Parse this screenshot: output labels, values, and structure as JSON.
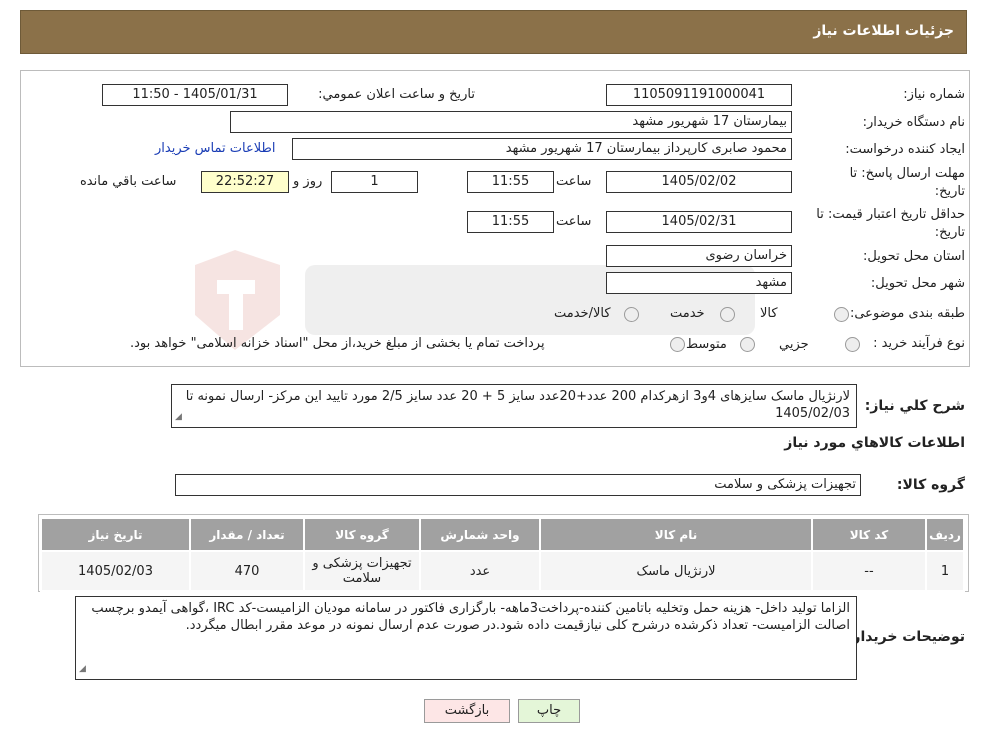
{
  "header": {
    "title": "جزئیات اطلاعات نیاز"
  },
  "fields": {
    "need_number_label": "شماره نیاز:",
    "need_number": "1105091191000041",
    "announce_label": "تاریخ و ساعت اعلان عمومي:",
    "announce_value": "1405/01/31 - 11:50",
    "buyer_org_label": "نام دستگاه خریدار:",
    "buyer_org": "بیمارستان 17 شهریور مشهد",
    "creator_label": "ایجاد کننده درخواست:",
    "creator": "محمود صابری کارپرداز بیمارستان 17 شهریور مشهد",
    "contact_link": "اطلاعات تماس خریدار",
    "deadline_label_1": "مهلت ارسال پاسخ: تا",
    "deadline_label_2": "تاریخ:",
    "deadline_date": "1405/02/02",
    "time_label": "ساعت",
    "deadline_time": "11:55",
    "days_value": "1",
    "days_label": "روز و",
    "remaining_time": "22:52:27",
    "remaining_label": "ساعت باقي مانده",
    "validity_label_1": "حداقل تاریخ اعتبار قیمت: تا",
    "validity_label_2": "تاریخ:",
    "validity_date": "1405/02/31",
    "validity_time": "11:55",
    "province_label": "استان محل تحویل:",
    "province": "خراسان رضوی",
    "city_label": "شهر محل تحویل:",
    "city": "مشهد",
    "category_label": "طبقه بندی موضوعی:",
    "category_options": [
      "کالا",
      "خدمت",
      "کالا/خدمت"
    ],
    "process_label": "نوع فرآیند خرید :",
    "process_options": [
      "جزیي",
      "متوسط"
    ],
    "process_note": "پرداخت تمام یا بخشی از مبلغ خرید،از محل \"اسناد خزانه اسلامی\" خواهد بود."
  },
  "summary": {
    "label": "شرح کلي نیاز:",
    "text": "لارنژیال ماسک سایزهای 4و3 ازهرکدام 200 عدد+20عدد سایز 5 + 20 عدد سایز 2/5 مورد تایید این مرکز- ارسال نمونه تا 1405/02/03"
  },
  "goods_info_title": "اطلاعات کالاهاي مورد نیاز",
  "goods_group": {
    "label": "گروه کالا:",
    "value": "تجهیزات پزشکی و سلامت"
  },
  "table": {
    "headers": [
      "ردیف",
      "کد کالا",
      "نام کالا",
      "واحد شمارش",
      "گروه کالا",
      "تعداد / مقدار",
      "تاریخ نیاز"
    ],
    "rows": [
      [
        "1",
        "--",
        "لارنژیال ماسک",
        "عدد",
        "تجهیزات پزشکی و سلامت",
        "470",
        "1405/02/03"
      ]
    ]
  },
  "buyer_notes": {
    "label": "توضیحات خریدار:",
    "text": "الزاما تولید داخل- هزینه حمل وتخلیه باتامین کننده-پرداخت3ماهه- بارگزاری فاکتور در سامانه مودیان الزامیست-کد IRC ،گواهی آیمدو برچسب اصالت الزامیست- تعداد ذکرشده درشرح کلی نیازقیمت داده شود.در صورت عدم ارسال نمونه در موعد مقرر ابطال میگردد."
  },
  "buttons": {
    "print": "چاپ",
    "back": "بازگشت"
  },
  "colors": {
    "header_bg": "#8b7149",
    "table_header_bg": "#a1a1a1",
    "remaining_bg": "#ffffcc",
    "back_btn_bg": "#fde6e6",
    "print_btn_bg": "#e4f6d8",
    "link": "#1a3db5"
  }
}
